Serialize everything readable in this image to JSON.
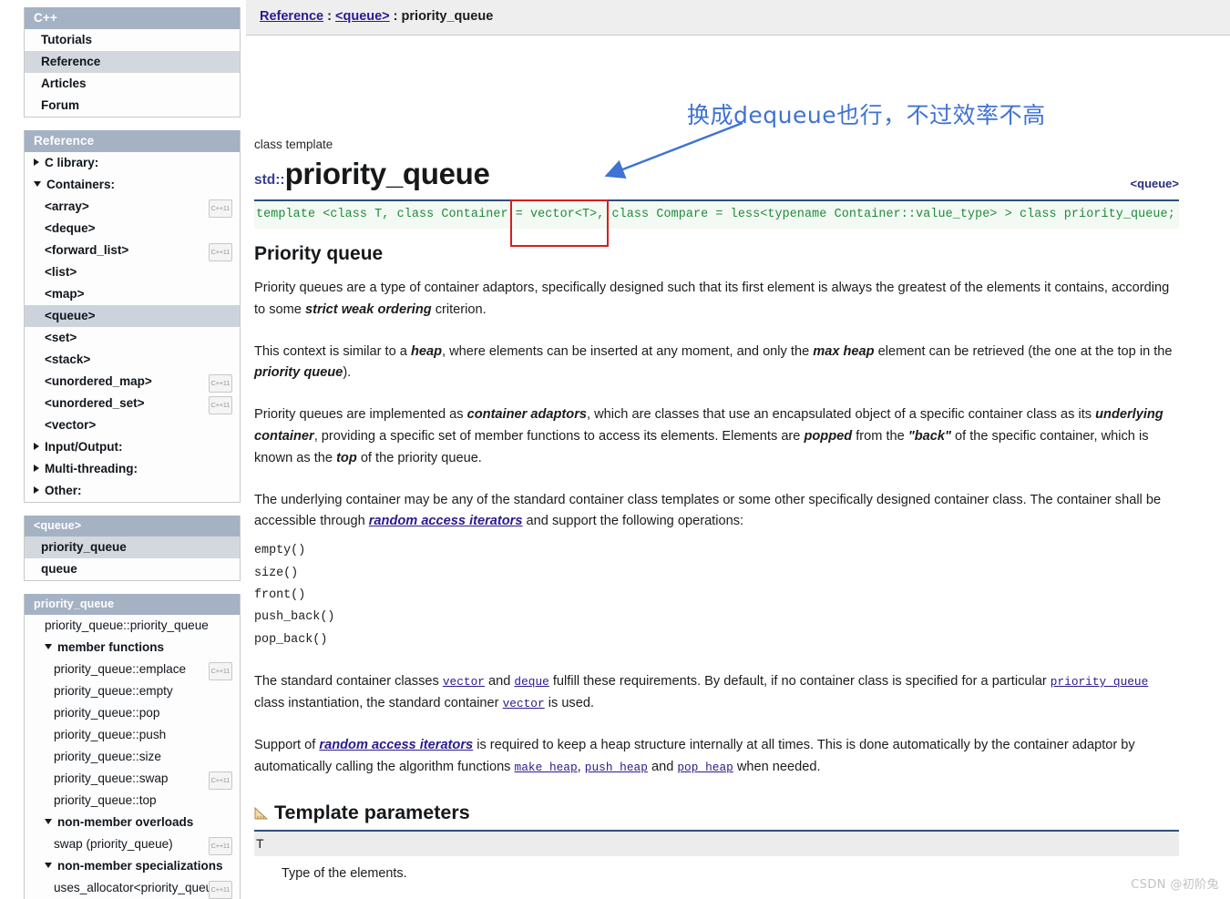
{
  "sidebar": {
    "cpp_panel": {
      "title": "C++",
      "items": [
        {
          "label": "Tutorials",
          "selected": false
        },
        {
          "label": "Reference",
          "selected": true
        },
        {
          "label": "Articles",
          "selected": false
        },
        {
          "label": "Forum",
          "selected": false
        }
      ]
    },
    "reference_panel": {
      "title": "Reference",
      "items": [
        {
          "label": "C library:",
          "arrow": "right",
          "indent": 0,
          "badge": ""
        },
        {
          "label": "Containers:",
          "arrow": "down",
          "indent": 0,
          "badge": ""
        },
        {
          "label": "<array>",
          "arrow": "",
          "indent": 1,
          "badge": "C++11"
        },
        {
          "label": "<deque>",
          "arrow": "",
          "indent": 1,
          "badge": ""
        },
        {
          "label": "<forward_list>",
          "arrow": "",
          "indent": 1,
          "badge": "C++11"
        },
        {
          "label": "<list>",
          "arrow": "",
          "indent": 1,
          "badge": ""
        },
        {
          "label": "<map>",
          "arrow": "",
          "indent": 1,
          "badge": ""
        },
        {
          "label": "<queue>",
          "arrow": "",
          "indent": 1,
          "badge": "",
          "selected": true
        },
        {
          "label": "<set>",
          "arrow": "",
          "indent": 1,
          "badge": ""
        },
        {
          "label": "<stack>",
          "arrow": "",
          "indent": 1,
          "badge": ""
        },
        {
          "label": "<unordered_map>",
          "arrow": "",
          "indent": 1,
          "badge": "C++11"
        },
        {
          "label": "<unordered_set>",
          "arrow": "",
          "indent": 1,
          "badge": "C++11"
        },
        {
          "label": "<vector>",
          "arrow": "",
          "indent": 1,
          "badge": ""
        },
        {
          "label": "Input/Output:",
          "arrow": "right",
          "indent": 0,
          "badge": ""
        },
        {
          "label": "Multi-threading:",
          "arrow": "right",
          "indent": 0,
          "badge": ""
        },
        {
          "label": "Other:",
          "arrow": "right",
          "indent": 0,
          "badge": ""
        }
      ]
    },
    "queue_panel": {
      "title": "<queue>",
      "items": [
        {
          "label": "priority_queue",
          "selected": true
        },
        {
          "label": "queue",
          "selected": false
        }
      ]
    },
    "priority_queue_panel": {
      "title": "priority_queue",
      "items": [
        {
          "label": "priority_queue::priority_queue",
          "bold": false,
          "arrow": "",
          "indent": 1,
          "badge": ""
        },
        {
          "label": "member functions",
          "bold": true,
          "arrow": "down",
          "indent": 1,
          "badge": ""
        },
        {
          "label": "priority_queue::emplace",
          "bold": false,
          "arrow": "",
          "indent": 2,
          "badge": "C++11"
        },
        {
          "label": "priority_queue::empty",
          "bold": false,
          "arrow": "",
          "indent": 2,
          "badge": ""
        },
        {
          "label": "priority_queue::pop",
          "bold": false,
          "arrow": "",
          "indent": 2,
          "badge": ""
        },
        {
          "label": "priority_queue::push",
          "bold": false,
          "arrow": "",
          "indent": 2,
          "badge": ""
        },
        {
          "label": "priority_queue::size",
          "bold": false,
          "arrow": "",
          "indent": 2,
          "badge": ""
        },
        {
          "label": "priority_queue::swap",
          "bold": false,
          "arrow": "",
          "indent": 2,
          "badge": "C++11"
        },
        {
          "label": "priority_queue::top",
          "bold": false,
          "arrow": "",
          "indent": 2,
          "badge": ""
        },
        {
          "label": "non-member overloads",
          "bold": true,
          "arrow": "down",
          "indent": 1,
          "badge": ""
        },
        {
          "label": "swap (priority_queue)",
          "bold": false,
          "arrow": "",
          "indent": 2,
          "badge": "C++11"
        },
        {
          "label": "non-member specializations",
          "bold": true,
          "arrow": "down",
          "indent": 1,
          "badge": ""
        },
        {
          "label": "uses_allocator<priority_queue>",
          "bold": false,
          "arrow": "",
          "indent": 2,
          "badge": "C++11"
        }
      ]
    }
  },
  "breadcrumb": {
    "root": "Reference",
    "sep1": " : ",
    "header": "<queue>",
    "sep2": " : ",
    "current": "priority_queue"
  },
  "main": {
    "kind_label": "class template",
    "namespace": "std::",
    "title": "priority_queue",
    "header_tag": "<queue>",
    "signature": "template <class T, class Container = vector<T>, class Compare = less<typename Container::value_type> > class priority_queue;",
    "section_title": "Priority queue",
    "para1_a": "Priority queues are a type of container adaptors, specifically designed such that its first element is always the greatest of the elements it contains, according to some ",
    "para1_em": "strict weak ordering",
    "para1_b": " criterion.",
    "para2_a": "This context is similar to a ",
    "para2_em1": "heap",
    "para2_b": ", where elements can be inserted at any moment, and only the ",
    "para2_em2": "max heap",
    "para2_c": " element can be retrieved (the one at the top in the ",
    "para2_em3": "priority queue",
    "para2_d": ").",
    "para3_a": "Priority queues are implemented as ",
    "para3_em1": "container adaptors",
    "para3_b": ", which are classes that use an encapsulated object of a specific container class as its ",
    "para3_em2": "underlying container",
    "para3_c": ", providing a specific set of member functions to access its elements. Elements are ",
    "para3_em3": "popped",
    "para3_d": " from the ",
    "para3_em4": "\"back\"",
    "para3_e": " of the specific container, which is known as the ",
    "para3_em5": "top",
    "para3_f": " of the priority queue.",
    "para4_a": "The underlying container may be any of the standard container class templates or some other specifically designed container class. The container shall be accessible through ",
    "para4_link": "random access iterators",
    "para4_b": " and support the following operations:",
    "operations": [
      "empty()",
      "size()",
      "front()",
      "push_back()",
      "pop_back()"
    ],
    "para5_a": "The standard container classes ",
    "para5_link1": "vector",
    "para5_b": " and ",
    "para5_link2": "deque",
    "para5_c": " fulfill these requirements. By default, if no container class is specified for a particular ",
    "para5_link3": "priority_queue",
    "para5_d": " class instantiation, the standard container ",
    "para5_link4": "vector",
    "para5_e": " is used.",
    "para6_a": "Support of ",
    "para6_link": "random access iterators",
    "para6_b": " is required to keep a heap structure internally at all times. This is done automatically by the container adaptor by automatically calling the algorithm functions ",
    "para6_link1": "make_heap",
    "para6_c": ", ",
    "para6_link2": "push_heap",
    "para6_d": " and ",
    "para6_link3": "pop_heap",
    "para6_e": " when needed.",
    "template_params_title": "Template parameters",
    "param_t_name": "T",
    "param_t_desc": "Type of the elements."
  },
  "annotation": {
    "text": "换成dequeue也行，不过效率不高",
    "color": "#3f72d4",
    "highlight_box_color": "#d81e1e"
  },
  "watermark": "CSDN @初阶兔"
}
